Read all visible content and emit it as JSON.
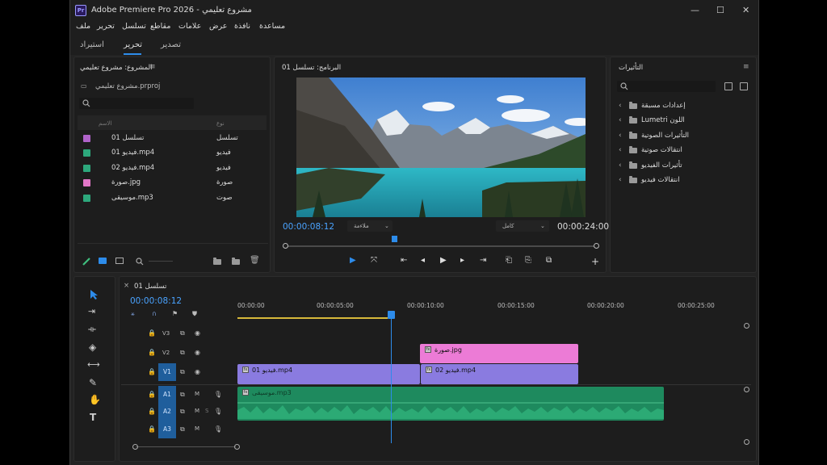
{
  "app": {
    "title": "Adobe Premiere Pro 2026 - مشروع تعليمي",
    "logo_text": "Pr",
    "minimize": "—",
    "maximize": "☐",
    "close": "✕"
  },
  "menu": [
    "مساعدة",
    "نافذة",
    "عرض",
    "علامات",
    "مقاطع",
    "تسلسل",
    "تحرير",
    "ملف"
  ],
  "workspaces": {
    "tabs": [
      "تصدير",
      "تحرير",
      "استيراد"
    ],
    "active": "تحرير"
  },
  "project": {
    "title": "المشروع: مشروع تعليمي",
    "menu_icon": "≡",
    "file": "مشروع تعليمي.prproj",
    "col_name": "الاسم",
    "col_type": "نوع",
    "items": [
      {
        "name": "تسلسل 01",
        "type": "تسلسل",
        "color": "#b063c9"
      },
      {
        "name": "فيديو 01.mp4",
        "type": "فيديو",
        "color": "#2da87c"
      },
      {
        "name": "فيديو 02.mp4",
        "type": "فيديو",
        "color": "#2da87c"
      },
      {
        "name": "صورة.jpg",
        "type": "صورة",
        "color": "#e277c8"
      },
      {
        "name": "موسيقى.mp3",
        "type": "صوت",
        "color": "#2da87c"
      }
    ]
  },
  "program": {
    "title": "البرنامج: تسلسل 01",
    "timecode": "00:00:08:12",
    "duration": "00:00:24:00",
    "fit": "ملاءمة",
    "quality": "كامل",
    "play_progress": 0.35
  },
  "effects": {
    "title": "التأثيرات",
    "menu_icon": "≡",
    "items": [
      "إعدادات مسبقة",
      "Lumetri اللون",
      "التأثيرات الصوتية",
      "انتقالات صوتية",
      "تأثيرات الفيديو",
      "انتقالات فيديو"
    ]
  },
  "timeline": {
    "title": "تسلسل 01",
    "close_icon": "×",
    "timecode": "00:00:08:12",
    "ruler": [
      "00:00:00",
      "00:00:05:00",
      "00:00:10:00",
      "00:00:15:00",
      "00:00:20:00",
      "00:00:25:00"
    ],
    "tracks": {
      "video": [
        "V3",
        "V2",
        "V1"
      ],
      "audio": [
        "A1",
        "A2",
        "A3"
      ],
      "mute": "M",
      "solo": "S"
    },
    "clips": {
      "image": "صورة.jpg",
      "video1": "فيديو 01.mp4",
      "video2": "فيديو 02.mp4",
      "audio": "موسيقى.mp3"
    },
    "colors": {
      "video": "#8a7be0",
      "image": "#ec7bd6",
      "audio": "#1e8a5e",
      "playhead": "#2d8ceb",
      "timecode": "#4aa3ff"
    }
  }
}
